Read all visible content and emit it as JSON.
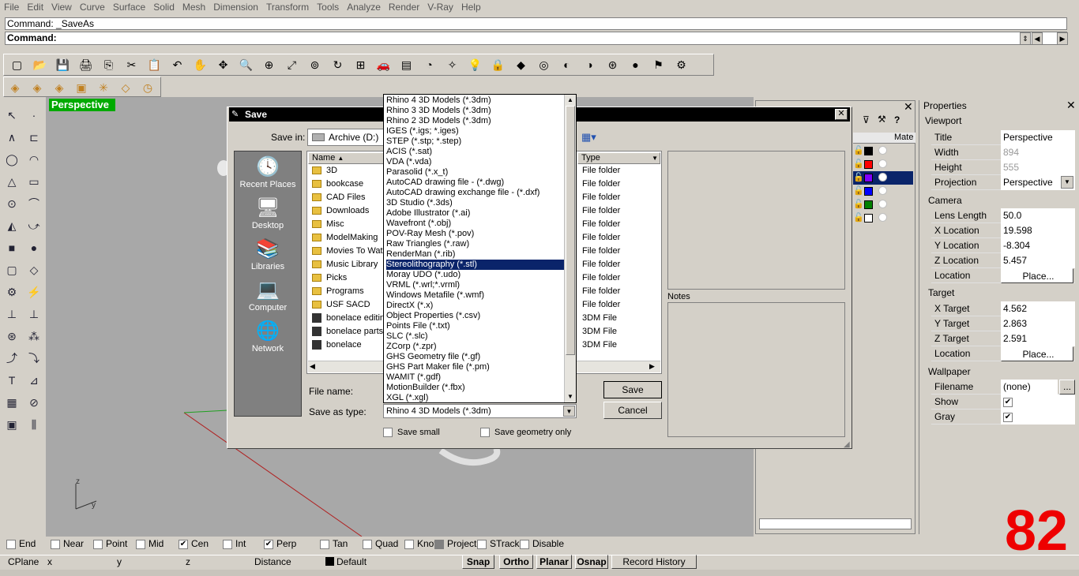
{
  "menu": [
    "File",
    "Edit",
    "View",
    "Curve",
    "Surface",
    "Solid",
    "Mesh",
    "Dimension",
    "Transform",
    "Tools",
    "Analyze",
    "Render",
    "V-Ray",
    "Help"
  ],
  "command": {
    "history": "Command: _SaveAs",
    "prompt": "Command:"
  },
  "viewport": {
    "title": "Perspective",
    "axis_z": "z",
    "axis_y": "y"
  },
  "dialog": {
    "title": "Save",
    "save_in_label": "Save in:",
    "save_in_value": "Archive (D:)",
    "places": [
      "Recent Places",
      "Desktop",
      "Libraries",
      "Computer",
      "Network"
    ],
    "columns": {
      "name": "Name",
      "type": "Type"
    },
    "files": [
      {
        "name": "3D",
        "type": "File folder",
        "kind": "folder"
      },
      {
        "name": "bookcase",
        "type": "File folder",
        "kind": "folder"
      },
      {
        "name": "CAD Files",
        "type": "File folder",
        "kind": "folder"
      },
      {
        "name": "Downloads",
        "type": "File folder",
        "kind": "folder"
      },
      {
        "name": "Misc",
        "type": "File folder",
        "kind": "folder"
      },
      {
        "name": "ModelMaking",
        "type": "File folder",
        "kind": "folder"
      },
      {
        "name": "Movies To Wat",
        "type": "File folder",
        "kind": "folder"
      },
      {
        "name": "Music Library",
        "type": "File folder",
        "kind": "folder"
      },
      {
        "name": "Picks",
        "type": "File folder",
        "kind": "folder"
      },
      {
        "name": "Programs",
        "type": "File folder",
        "kind": "folder"
      },
      {
        "name": "USF SACD",
        "type": "File folder",
        "kind": "folder"
      },
      {
        "name": "bonelace editin",
        "type": "3DM File",
        "kind": "file"
      },
      {
        "name": "bonelace parts",
        "type": "3DM File",
        "kind": "file"
      },
      {
        "name": "bonelace",
        "type": "3DM File",
        "kind": "file"
      }
    ],
    "file_name_label": "File name:",
    "save_type_label": "Save as type:",
    "save_type_value": "Rhino 4 3D Models (*.3dm)",
    "save_button": "Save",
    "cancel_button": "Cancel",
    "notes_label": "Notes",
    "save_small": "Save small",
    "save_geometry_only": "Save geometry only",
    "file_types": [
      "Rhino 4 3D Models (*.3dm)",
      "Rhino 3 3D Models (*.3dm)",
      "Rhino 2 3D Models (*.3dm)",
      "IGES (*.igs; *.iges)",
      "STEP (*.stp; *.step)",
      "ACIS (*.sat)",
      "VDA (*.vda)",
      "Parasolid (*.x_t)",
      "AutoCAD drawing file - (*.dwg)",
      "AutoCAD drawing exchange file - (*.dxf)",
      "3D Studio (*.3ds)",
      "Adobe Illustrator (*.ai)",
      "Wavefront (*.obj)",
      "POV-Ray Mesh (*.pov)",
      "Raw Triangles (*.raw)",
      "RenderMan (*.rib)",
      "Stereolithography (*.stl)",
      "Moray UDO (*.udo)",
      "VRML (*.wrl;*.vrml)",
      "Windows Metafile (*.wmf)",
      "DirectX (*.x)",
      "Object Properties (*.csv)",
      "Points File (*.txt)",
      "SLC (*.slc)",
      "ZCorp (*.zpr)",
      "GHS Geometry file (*.gf)",
      "GHS Part Maker file (*.pm)",
      "WAMIT (*.gdf)",
      "MotionBuilder (*.fbx)",
      "XGL (*.xgl)"
    ],
    "selected_type": "Stereolithography (*.stl)"
  },
  "layers": {
    "header": "Mate",
    "colors": [
      "#000000",
      "#ff0000",
      "#8000ff",
      "#0000ff",
      "#008000",
      "#ffffff"
    ]
  },
  "properties": {
    "title": "Properties",
    "viewport_section": "Viewport",
    "rows_viewport": [
      {
        "k": "Title",
        "v": "Perspective",
        "gray": false
      },
      {
        "k": "Width",
        "v": "894",
        "gray": true
      },
      {
        "k": "Height",
        "v": "555",
        "gray": true
      },
      {
        "k": "Projection",
        "v": "Perspective",
        "gray": false
      }
    ],
    "camera_section": "Camera",
    "rows_camera": [
      {
        "k": "Lens Length",
        "v": "50.0"
      },
      {
        "k": "X Location",
        "v": "19.598"
      },
      {
        "k": "Y Location",
        "v": "-8.304"
      },
      {
        "k": "Z Location",
        "v": "5.457"
      },
      {
        "k": "Location",
        "v": "Place..."
      }
    ],
    "target_section": "Target",
    "rows_target": [
      {
        "k": "X Target",
        "v": "4.562"
      },
      {
        "k": "Y Target",
        "v": "2.863"
      },
      {
        "k": "Z Target",
        "v": "2.591"
      },
      {
        "k": "Location",
        "v": "Place..."
      }
    ],
    "wallpaper_section": "Wallpaper",
    "wallpaper_filename_label": "Filename",
    "wallpaper_filename": "(none)",
    "wallpaper_browse": "...",
    "wallpaper_show": "Show",
    "wallpaper_gray": "Gray"
  },
  "osnaps": [
    {
      "label": "End",
      "checked": false
    },
    {
      "label": "Near",
      "checked": false
    },
    {
      "label": "Point",
      "checked": false
    },
    {
      "label": "Mid",
      "checked": false
    },
    {
      "label": "Cen",
      "checked": true
    },
    {
      "label": "Int",
      "checked": false
    },
    {
      "label": "Perp",
      "checked": true
    },
    {
      "label": "Tan",
      "checked": false
    },
    {
      "label": "Quad",
      "checked": false
    },
    {
      "label": "Knot",
      "checked": false
    },
    {
      "label": "Project",
      "checked": false
    },
    {
      "label": "STrack",
      "checked": false
    },
    {
      "label": "Disable",
      "checked": false
    }
  ],
  "status": {
    "cplane": "CPlane",
    "x": "x",
    "y": "y",
    "z": "z",
    "distance": "Distance",
    "layer": "Default",
    "snap": "Snap",
    "ortho": "Ortho",
    "planar": "Planar",
    "osnap": "Osnap",
    "record_history": "Record History"
  },
  "overlay_number": "82"
}
